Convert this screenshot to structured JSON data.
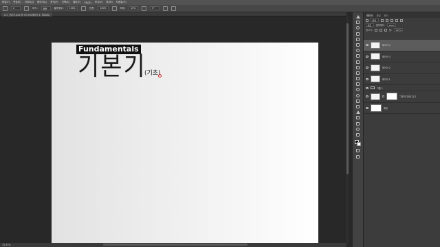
{
  "menubar": {
    "items": [
      "파일(F)",
      "편집(E)",
      "이미지(I)",
      "레이어(L)",
      "문자(Y)",
      "선택(S)",
      "필터(T)",
      "3D(D)",
      "보기(V)",
      "창(W)",
      "도움말(H)"
    ]
  },
  "options": {
    "size_value": "2",
    "mode_label": "모드:",
    "mode_value": "표준",
    "opacity_label": "불투명도:",
    "opacity_value": "100%",
    "flow_label": "흐름:",
    "flow_value": "100%",
    "smoothing_label": "보정:",
    "smoothing_value": "10%",
    "angle_value": "0°"
  },
  "document": {
    "tab_title": "0-1_기본기.psd @ 33.3%(레이어 4, RGB/8)",
    "label": "Fundamentals",
    "main_text": "기본기",
    "sub_text": "(기초)"
  },
  "status": {
    "zoom": "33.33%"
  },
  "panel": {
    "tabs": [
      "레이어",
      "채널",
      "패스"
    ],
    "kind_label": "종류",
    "blend_mode": "표준",
    "opacity_label": "불투명도:",
    "opacity_value": "100%",
    "lock_label": "잠그기:",
    "fill_label": "칠:",
    "fill_value": "100%"
  },
  "layers": [
    {
      "name": "레이어 4",
      "selected": true
    },
    {
      "name": "레이어 3",
      "selected": false
    },
    {
      "name": "레이어 2",
      "selected": false
    },
    {
      "name": "레이어 1",
      "selected": false
    },
    {
      "name": "그룹 1",
      "selected": false
    },
    {
      "name": "그레이디언트 칠 1",
      "selected": false
    },
    {
      "name": "배경",
      "selected": false
    }
  ],
  "colors": {
    "accent_red": "#d02020",
    "canvas_light": "#ffffff",
    "workspace": "#282828"
  }
}
